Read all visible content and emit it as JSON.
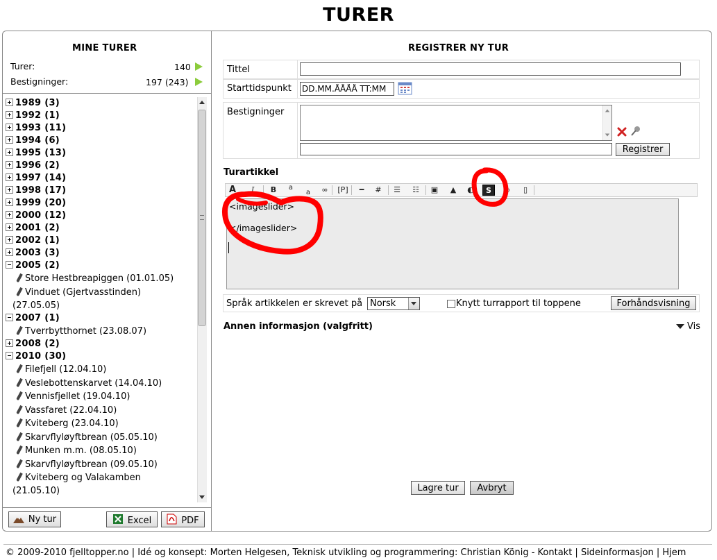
{
  "page": {
    "title": "TURER"
  },
  "left": {
    "title": "MINE TURER",
    "stats": [
      {
        "label": "Turer:",
        "value": "140"
      },
      {
        "label": "Bestigninger:",
        "value": "197 (243)"
      }
    ],
    "years": [
      {
        "label": "1989 (3)",
        "expanded": false,
        "trips": []
      },
      {
        "label": "1992 (1)",
        "expanded": false,
        "trips": []
      },
      {
        "label": "1993 (11)",
        "expanded": false,
        "trips": []
      },
      {
        "label": "1994 (6)",
        "expanded": false,
        "trips": []
      },
      {
        "label": "1995 (13)",
        "expanded": false,
        "trips": []
      },
      {
        "label": "1996 (2)",
        "expanded": false,
        "trips": []
      },
      {
        "label": "1997 (14)",
        "expanded": false,
        "trips": []
      },
      {
        "label": "1998 (17)",
        "expanded": false,
        "trips": []
      },
      {
        "label": "1999 (20)",
        "expanded": false,
        "trips": []
      },
      {
        "label": "2000 (12)",
        "expanded": false,
        "trips": []
      },
      {
        "label": "2001 (2)",
        "expanded": false,
        "trips": []
      },
      {
        "label": "2002 (1)",
        "expanded": false,
        "trips": []
      },
      {
        "label": "2003 (3)",
        "expanded": false,
        "trips": []
      },
      {
        "label": "2005 (2)",
        "expanded": true,
        "trips": [
          {
            "name": "Store Hestbreapiggen (01.01.05)"
          },
          {
            "name": "Vinduet (Gjertvasstinden)",
            "cont": "(27.05.05)"
          }
        ]
      },
      {
        "label": "2007 (1)",
        "expanded": true,
        "trips": [
          {
            "name": "Tverrbytthornet (23.08.07)"
          }
        ]
      },
      {
        "label": "2008 (2)",
        "expanded": false,
        "trips": []
      },
      {
        "label": "2010 (30)",
        "expanded": true,
        "trips": [
          {
            "name": "Filefjell (12.04.10)"
          },
          {
            "name": "Veslebottenskarvet (14.04.10)"
          },
          {
            "name": "Vennisfjellet (19.04.10)"
          },
          {
            "name": "Vassfaret (22.04.10)"
          },
          {
            "name": "Kviteberg (23.04.10)"
          },
          {
            "name": "Skarvflyløyftbrean (05.05.10)"
          },
          {
            "name": "Munken m.m. (08.05.10)"
          },
          {
            "name": "Skarvflyløyftbrean (09.05.10)"
          },
          {
            "name": "Kviteberg og Valakamben",
            "cont": "(21.05.10)"
          }
        ]
      }
    ],
    "buttons": {
      "new_trip": "Ny tur",
      "excel": "Excel",
      "pdf": "PDF"
    }
  },
  "form": {
    "title": "REGISTRER NY TUR",
    "title_label": "Tittel",
    "title_value": "",
    "start_label": "Starttidspunkt",
    "start_value": "DD.MM.ÅÅÅÅ TT:MM",
    "ascents_label": "Bestigninger",
    "register_button": "Registrer",
    "article_heading": "Turartikkel",
    "editor_lines": [
      "<imageslider>",
      "",
      "</imageslider>"
    ],
    "language_label": "Språk artikkelen er skrevet på",
    "language_value": "Norsk",
    "link_report_label": "Knytt turrapport til toppene",
    "preview_button": "Forhåndsvisning",
    "other_info": "Annen informasjon (valgfritt)",
    "show_label": "Vis",
    "save_button": "Lagre tur",
    "cancel_button": "Avbryt"
  },
  "toolbar": {
    "buttons": [
      {
        "name": "bold-icon",
        "glyph": "B"
      },
      {
        "name": "superscript-icon",
        "glyph": "a"
      },
      {
        "name": "subscript-icon",
        "glyph": "a"
      },
      {
        "name": "link-icon",
        "glyph": "∞"
      },
      {
        "name": "paragraph-icon",
        "glyph": "[P]"
      },
      {
        "name": "horizontal-rule-icon",
        "glyph": "━"
      },
      {
        "name": "table-icon",
        "glyph": "#"
      },
      {
        "name": "bullet-list-icon",
        "glyph": "☰"
      },
      {
        "name": "numbered-list-icon",
        "glyph": "☷"
      },
      {
        "name": "image-icon",
        "glyph": "▣"
      },
      {
        "name": "image-upload-icon",
        "glyph": "▲"
      },
      {
        "name": "gallery-icon",
        "glyph": "◐"
      },
      {
        "name": "imageslider-icon",
        "glyph": "S"
      },
      {
        "name": "unlink-icon",
        "glyph": "∞"
      },
      {
        "name": "document-icon",
        "glyph": "▯"
      }
    ]
  },
  "footer": {
    "text": "© 2009-2010 fjelltopper.no | Idé og konsept: Morten Helgesen, Teknisk utvikling og programmering: Christian König  -  Kontakt | Sideinformasjon | Hjem"
  },
  "colors": {
    "accent_green": "#8ccc3c",
    "annotation_red": "#ff0000"
  }
}
